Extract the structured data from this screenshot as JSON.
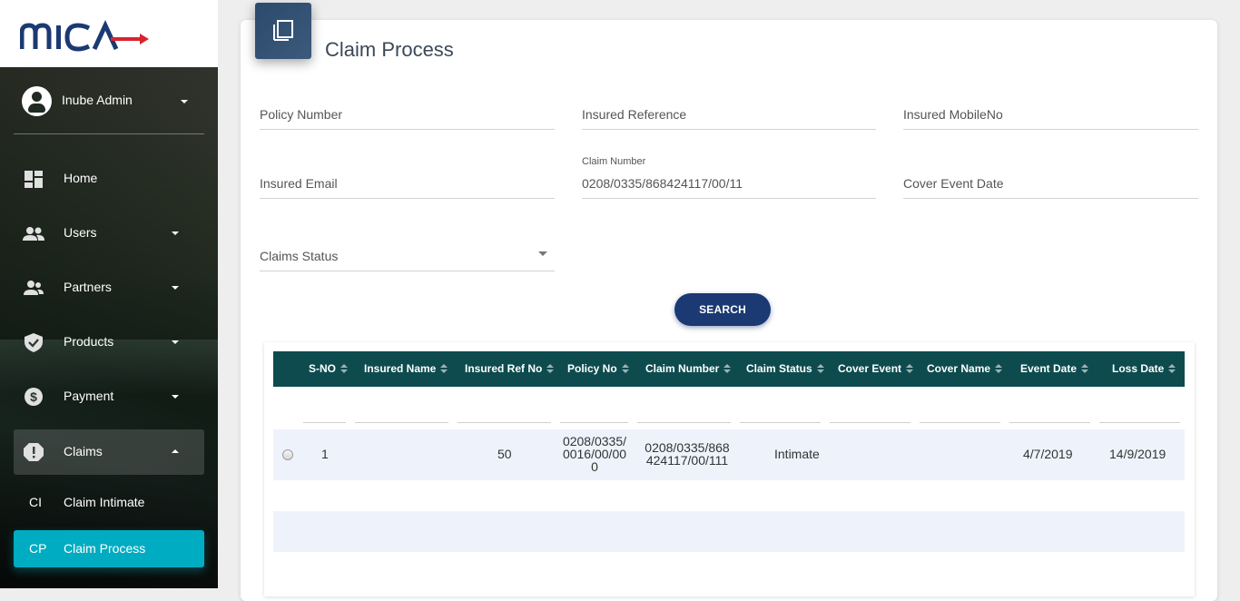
{
  "sidebar": {
    "brand": "MICA",
    "user": {
      "name": "Inube Admin"
    },
    "items": [
      {
        "label": "Home",
        "icon": "dashboard-icon"
      },
      {
        "label": "Users",
        "icon": "users-icon"
      },
      {
        "label": "Partners",
        "icon": "partners-icon"
      },
      {
        "label": "Products",
        "icon": "shield-check-icon"
      },
      {
        "label": "Payment",
        "icon": "dollar-circle-icon"
      },
      {
        "label": "Claims",
        "icon": "alert-circle-icon"
      }
    ],
    "sub_items": [
      {
        "abbr": "CI",
        "label": "Claim Intimate"
      },
      {
        "abbr": "CP",
        "label": "Claim Process"
      }
    ]
  },
  "main": {
    "title": "Claim Process",
    "fields": {
      "policy_number": {
        "placeholder": "Policy Number"
      },
      "insured_reference": {
        "placeholder": "Insured Reference"
      },
      "insured_mobile": {
        "placeholder": "Insured MobileNo"
      },
      "insured_email": {
        "placeholder": "Insured Email"
      },
      "claim_number": {
        "label": "Claim Number",
        "value": "0208/0335/868424117/00/11"
      },
      "cover_event_date": {
        "placeholder": "Cover Event Date"
      },
      "claims_status": {
        "placeholder": "Claims Status"
      }
    },
    "search_label": "SEARCH",
    "table": {
      "headers": [
        "S-NO",
        "Insured Name",
        "Insured Ref No",
        "Policy No",
        "Claim Number",
        "Claim Status",
        "Cover Event",
        "Cover Name",
        "Event Date",
        "Loss Date"
      ],
      "rows": [
        {
          "sno": "1",
          "insured_name": "",
          "insured_ref_no": "50",
          "policy_no": [
            "0208/0335/",
            "0016/00/00",
            "0"
          ],
          "claim_number": [
            "0208/0335/868",
            "424117/00/111"
          ],
          "claim_status": "Intimate",
          "cover_event": "",
          "cover_name": "",
          "event_date": "4/7/2019",
          "loss_date": "14/9/2019"
        }
      ]
    }
  },
  "colors": {
    "accent": "#00acc1",
    "table_header": "#0d4b4f",
    "button": "#1b3a73",
    "row_bg": "#eef3fb"
  }
}
